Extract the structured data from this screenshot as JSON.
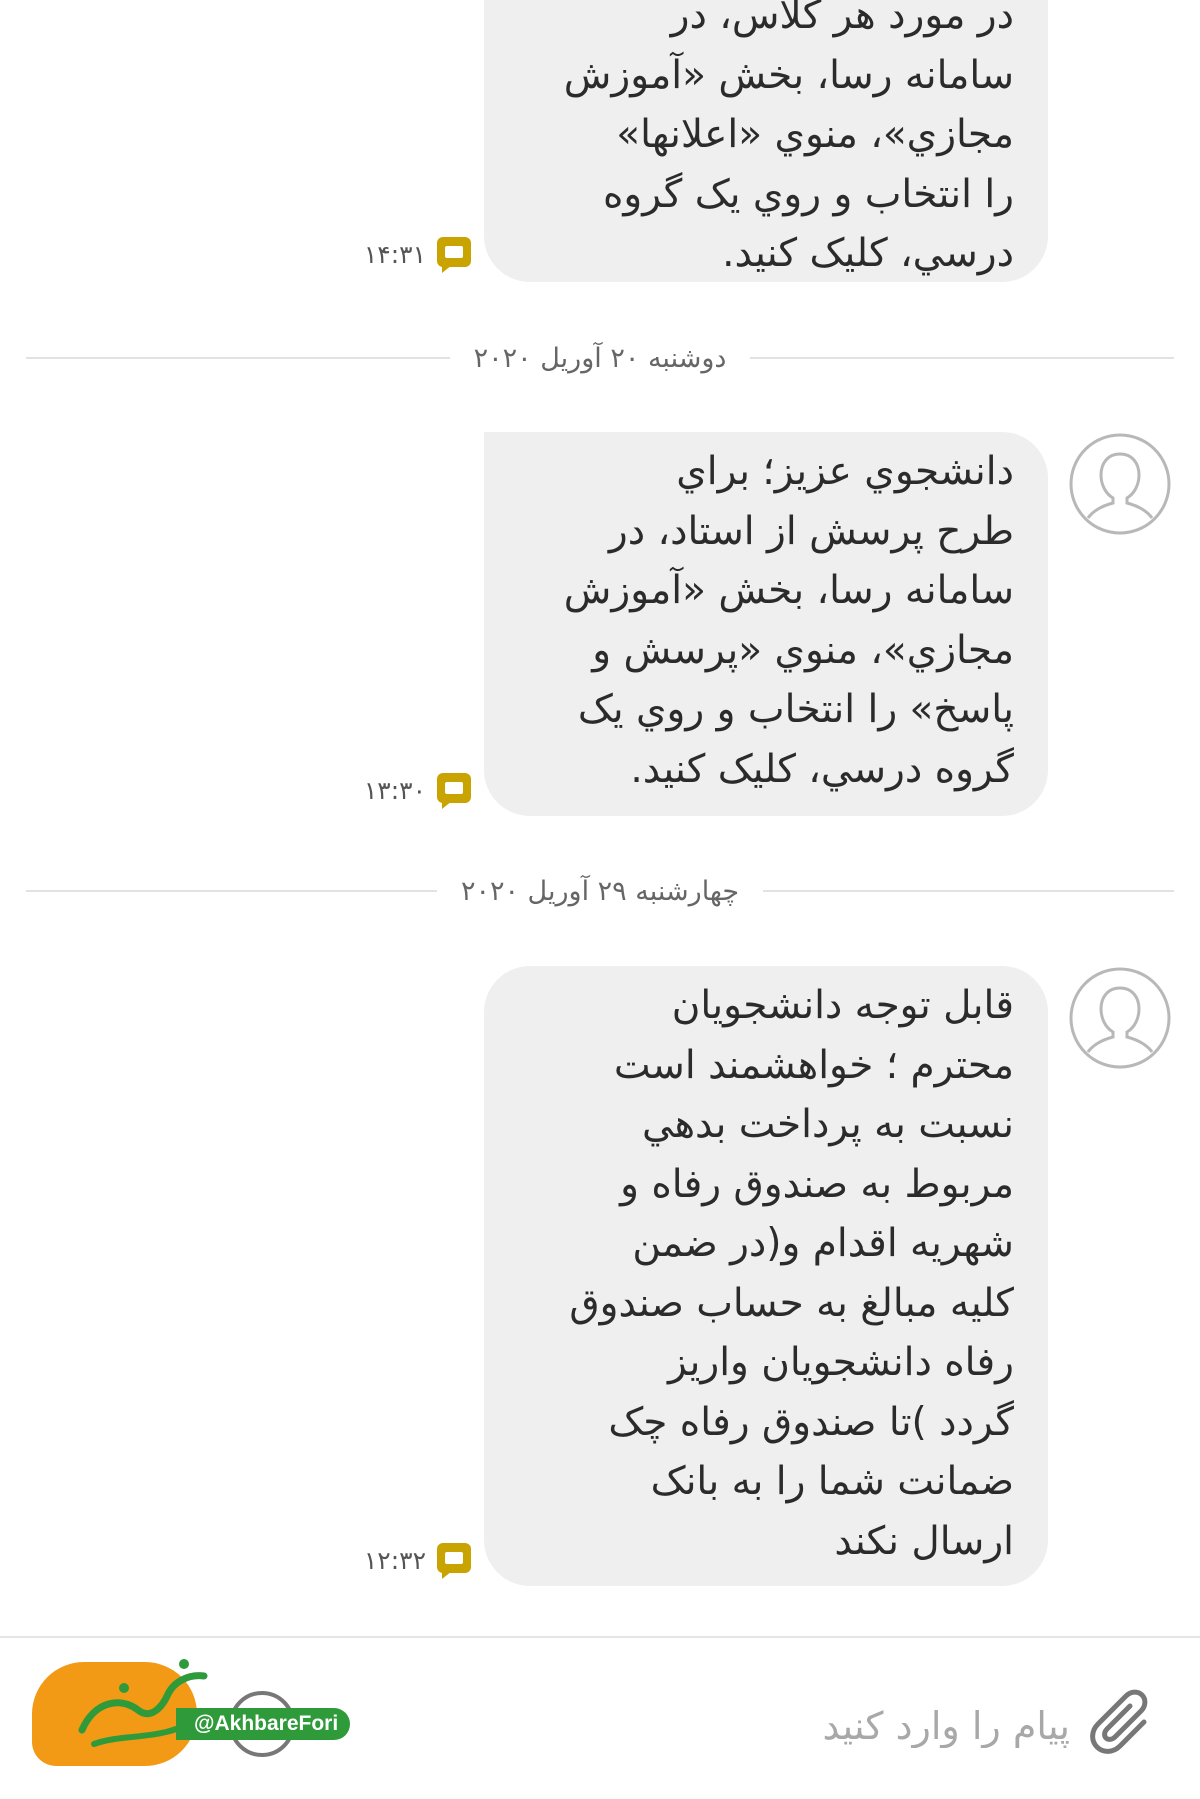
{
  "conversation": {
    "messages": [
      {
        "lines": [
          "در مورد هر کلاس، در",
          "سامانه رسا، بخش «آموزش",
          "مجازي»، منوي «اعلانها»",
          "را انتخاب و روي يک گروه",
          "درسي، کليک کنيد."
        ],
        "time": "۱۴:۳۱"
      },
      {
        "lines": [
          "دانشجوي عزيز؛ براي",
          "طرح پرسش از استاد، در",
          "سامانه رسا، بخش «آموزش",
          "مجازي»، منوي «پرسش و",
          "پاسخ» را انتخاب و روي يک",
          "گروه درسي، کليک کنيد."
        ],
        "time": "۱۳:۳۰"
      },
      {
        "lines": [
          "قابل توجه دانشجويان",
          "محترم ؛ خواهشمند است",
          "نسبت به  پرداخت بدهي",
          "مربوط به صندوق رفاه و",
          "شهريه اقدام و(در ضمن",
          "کليه مبالغ به حساب صندوق",
          "رفاه دانشجويان واريز",
          "گردد )تا صندوق  رفاه چک",
          "ضمانت شما  را به بانک",
          "ارسال  نکند"
        ],
        "time": "۱۲:۳۲"
      }
    ],
    "date_dividers": [
      "دوشنبه ۲۰ آوريل ۲۰۲۰",
      "چهارشنبه ۲۹ آوريل ۲۰۲۰"
    ],
    "icons": {
      "message_status": "sms-icon",
      "avatar": "contact-avatar-icon",
      "attach": "paperclip-icon",
      "emoji": "emoji-icon"
    }
  },
  "compose": {
    "placeholder": "پيام را وارد کنيد",
    "value": ""
  },
  "watermark": {
    "handle": "@AkhbareFori"
  },
  "colors": {
    "bubble": "#efefef",
    "status_icon": "#c9a400",
    "watermark_orange": "#f29a16",
    "watermark_green": "#2f9a3a"
  }
}
